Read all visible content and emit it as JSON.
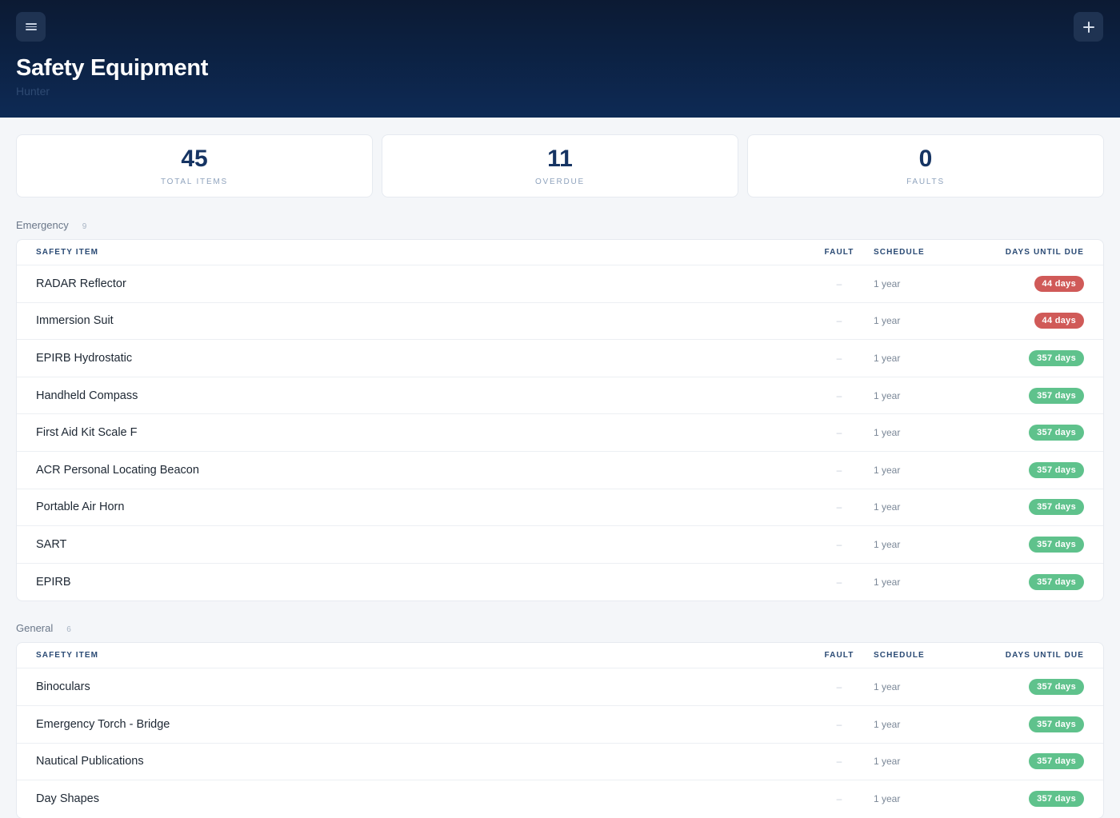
{
  "header": {
    "title": "Safety Equipment",
    "subtitle": "Hunter",
    "menu_icon": "menu-icon",
    "add_icon": "plus-icon"
  },
  "stats": [
    {
      "value": "45",
      "label": "TOTAL ITEMS"
    },
    {
      "value": "11",
      "label": "OVERDUE"
    },
    {
      "value": "0",
      "label": "FAULTS"
    }
  ],
  "columns": {
    "item": "SAFETY ITEM",
    "fault": "FAULT",
    "schedule": "SCHEDULE",
    "days": "DAYS UNTIL DUE"
  },
  "colors": {
    "overdue": "#d05a58",
    "ok": "#5fc28c",
    "header_bg": "#0c1a33"
  },
  "sections": [
    {
      "name": "Emergency",
      "count": "9",
      "rows": [
        {
          "item": "RADAR Reflector",
          "fault": "–",
          "schedule": "1 year",
          "days": "44 days",
          "status": "red"
        },
        {
          "item": "Immersion Suit",
          "fault": "–",
          "schedule": "1 year",
          "days": "44 days",
          "status": "red"
        },
        {
          "item": "EPIRB Hydrostatic",
          "fault": "–",
          "schedule": "1 year",
          "days": "357 days",
          "status": "green"
        },
        {
          "item": "Handheld Compass",
          "fault": "–",
          "schedule": "1 year",
          "days": "357 days",
          "status": "green"
        },
        {
          "item": "First Aid Kit Scale F",
          "fault": "–",
          "schedule": "1 year",
          "days": "357 days",
          "status": "green"
        },
        {
          "item": "ACR Personal Locating Beacon",
          "fault": "–",
          "schedule": "1 year",
          "days": "357 days",
          "status": "green"
        },
        {
          "item": "Portable Air Horn",
          "fault": "–",
          "schedule": "1 year",
          "days": "357 days",
          "status": "green"
        },
        {
          "item": "SART",
          "fault": "–",
          "schedule": "1 year",
          "days": "357 days",
          "status": "green"
        },
        {
          "item": "EPIRB",
          "fault": "–",
          "schedule": "1 year",
          "days": "357 days",
          "status": "green"
        }
      ]
    },
    {
      "name": "General",
      "count": "6",
      "rows": [
        {
          "item": "Binoculars",
          "fault": "–",
          "schedule": "1 year",
          "days": "357 days",
          "status": "green"
        },
        {
          "item": "Emergency Torch - Bridge",
          "fault": "–",
          "schedule": "1 year",
          "days": "357 days",
          "status": "green"
        },
        {
          "item": "Nautical Publications",
          "fault": "–",
          "schedule": "1 year",
          "days": "357 days",
          "status": "green"
        },
        {
          "item": "Day Shapes",
          "fault": "–",
          "schedule": "1 year",
          "days": "357 days",
          "status": "green"
        }
      ]
    }
  ]
}
